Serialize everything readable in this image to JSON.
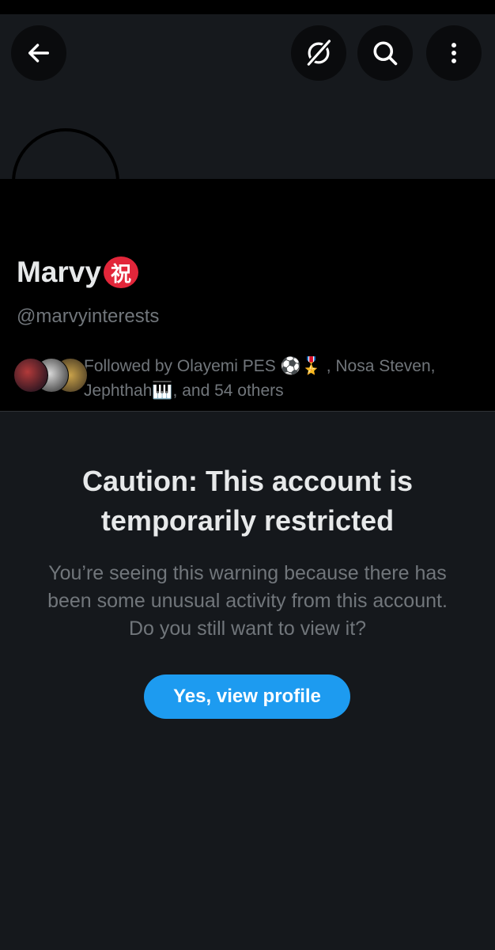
{
  "header": {
    "back_icon": "arrow-left-icon",
    "grok_icon": "grok-icon",
    "search_icon": "search-icon",
    "more_icon": "more-vertical-icon"
  },
  "profile": {
    "name": "Marvy",
    "name_badge": "祝",
    "handle": "@marvyinterests",
    "followed_by": "Followed by Olayemi PES ⚽🎖️ , Nosa Steven, Jephthah🎹, and 54 others"
  },
  "warning": {
    "title": "Caution: This account is temporarily restricted",
    "body": "You’re seeing this warning because there has been some unusual activity from this account. Do you still want to view it?",
    "button_label": "Yes, view profile"
  },
  "colors": {
    "accent": "#1d9bf0",
    "badge": "#e2263a"
  }
}
